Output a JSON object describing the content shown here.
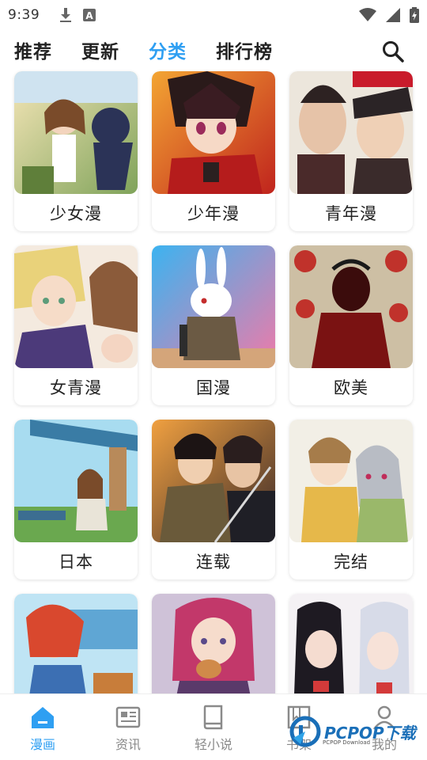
{
  "status_bar": {
    "time": "9:39",
    "left_icons": [
      "download-icon",
      "font-icon"
    ],
    "right_icons": [
      "wifi-icon",
      "signal-icon",
      "battery-charging-icon"
    ]
  },
  "top_tabs": [
    {
      "label": "推荐",
      "active": false
    },
    {
      "label": "更新",
      "active": false
    },
    {
      "label": "分类",
      "active": true
    },
    {
      "label": "排行榜",
      "active": false
    }
  ],
  "search_icon": "search-icon",
  "categories": [
    {
      "label": "少女漫"
    },
    {
      "label": "少年漫"
    },
    {
      "label": "青年漫"
    },
    {
      "label": "女青漫"
    },
    {
      "label": "国漫"
    },
    {
      "label": "欧美"
    },
    {
      "label": "日本"
    },
    {
      "label": "连载"
    },
    {
      "label": "完结"
    }
  ],
  "bottom_nav": [
    {
      "label": "漫画",
      "icon": "home-icon",
      "active": true
    },
    {
      "label": "资讯",
      "icon": "news-icon",
      "active": false
    },
    {
      "label": "轻小说",
      "icon": "book-icon",
      "active": false
    },
    {
      "label": "书架",
      "icon": "bookshelf-icon",
      "active": false
    },
    {
      "label": "我的",
      "icon": "profile-icon",
      "active": false
    }
  ],
  "watermark": {
    "text": "PCPOP下载",
    "subtext": "PCPOP Download"
  },
  "colors": {
    "accent": "#2f9ff2",
    "text": "#222222",
    "muted": "#8a8a8a"
  }
}
